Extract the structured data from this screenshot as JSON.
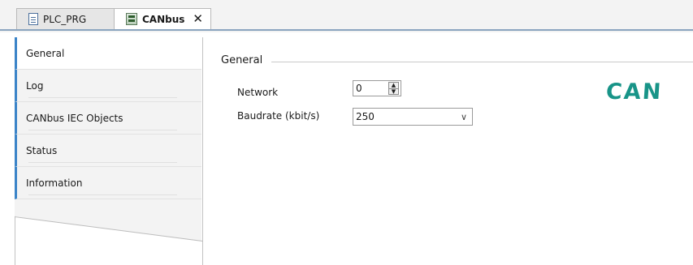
{
  "tabs": [
    {
      "label": "PLC_PRG",
      "icon": "document-icon",
      "active": false
    },
    {
      "label": "CANbus",
      "icon": "device-icon",
      "active": true,
      "close": "✕"
    }
  ],
  "sidebar": {
    "items": [
      {
        "label": "General",
        "active": true
      },
      {
        "label": "Log",
        "active": false
      },
      {
        "label": "CANbus IEC Objects",
        "active": false
      },
      {
        "label": "Status",
        "active": false
      },
      {
        "label": "Information",
        "active": false
      }
    ]
  },
  "main": {
    "group_title": "General",
    "network": {
      "label": "Network",
      "value": "0"
    },
    "baudrate": {
      "label": "Baudrate (kbit/s)",
      "value": "250"
    },
    "logo_text": "CAN"
  },
  "colors": {
    "accent": "#3b84c8",
    "logo": "#189488"
  }
}
